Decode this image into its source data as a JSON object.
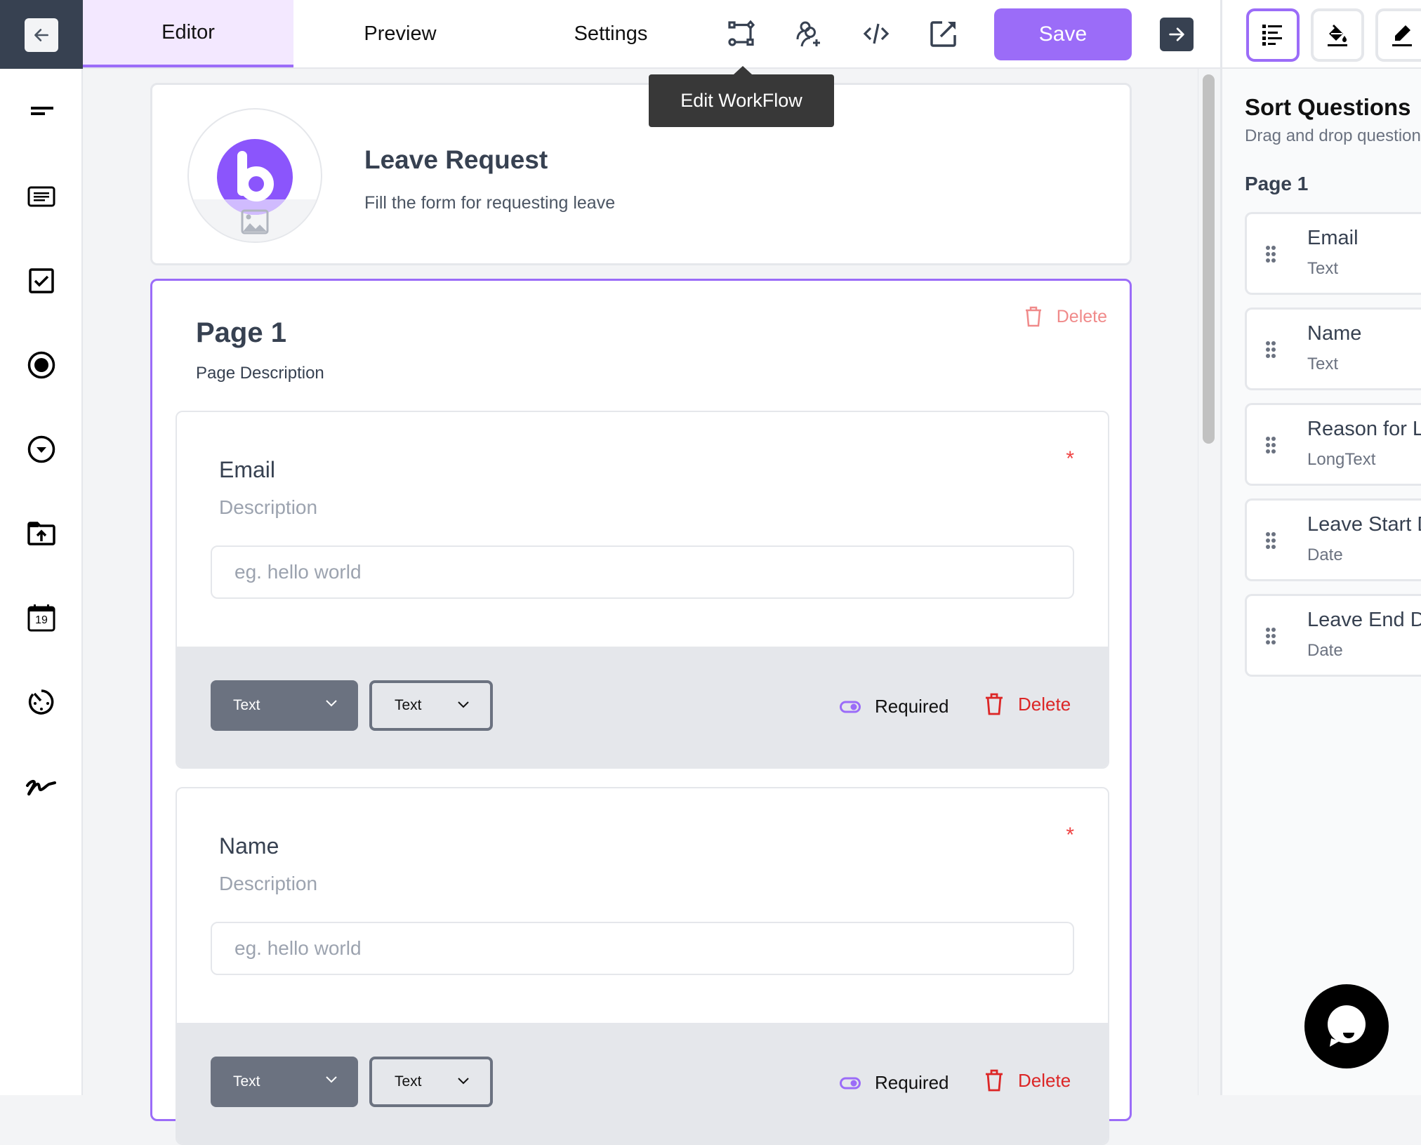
{
  "topbar": {
    "tabs": [
      {
        "label": "Editor",
        "active": true
      },
      {
        "label": "Preview",
        "active": false
      },
      {
        "label": "Settings",
        "active": false
      }
    ],
    "icons": [
      "workflow-icon",
      "user-add-icon",
      "code-icon",
      "external-link-icon"
    ],
    "save_label": "Save",
    "tooltip": "Edit WorkFlow"
  },
  "left_rail": {
    "items": [
      {
        "icon": "short-text-icon",
        "label": "Short Text"
      },
      {
        "icon": "long-text-icon",
        "label": "Long Text"
      },
      {
        "icon": "checkbox-icon",
        "label": "Checkbox"
      },
      {
        "icon": "radio-icon",
        "label": "Radio"
      },
      {
        "icon": "dropdown-icon",
        "label": "Dropdown"
      },
      {
        "icon": "file-upload-icon",
        "label": "File Upload"
      },
      {
        "icon": "calendar-icon",
        "label": "Date",
        "day": "19"
      },
      {
        "icon": "timer-icon",
        "label": "Time"
      },
      {
        "icon": "signature-icon",
        "label": "Signature"
      }
    ]
  },
  "form": {
    "title": "Leave Request",
    "description": "Fill the form for requesting leave"
  },
  "page": {
    "title": "Page 1",
    "description": "Page Description",
    "delete_label": "Delete"
  },
  "questions": [
    {
      "title": "Email",
      "description": "Description",
      "required_marker": "*",
      "placeholder": "eg. hello world",
      "type_select": "Text",
      "format_select": "Text",
      "required_label": "Required",
      "required": true,
      "delete_label": "Delete"
    },
    {
      "title": "Name",
      "description": "Description",
      "required_marker": "*",
      "placeholder": "eg. hello world",
      "type_select": "Text",
      "format_select": "Text",
      "required_label": "Required",
      "required": true,
      "delete_label": "Delete"
    }
  ],
  "right_panel": {
    "tool_buttons": [
      "list-icon",
      "paint-bucket-icon",
      "pen-icon"
    ],
    "title": "Sort Questions",
    "subtitle": "Drag and drop questions",
    "page_label": "Page 1",
    "items": [
      {
        "name": "Email",
        "type": "Text"
      },
      {
        "name": "Name",
        "type": "Text"
      },
      {
        "name": "Reason for Leave",
        "type": "LongText"
      },
      {
        "name": "Leave Start Date",
        "type": "Date"
      },
      {
        "name": "Leave End Date",
        "type": "Date"
      }
    ]
  },
  "colors": {
    "accent": "#9b6cf8",
    "tab_active_bg": "#f3e8ff",
    "dark": "#374151",
    "danger": "#dc2626",
    "danger_light": "#f08a8a"
  }
}
